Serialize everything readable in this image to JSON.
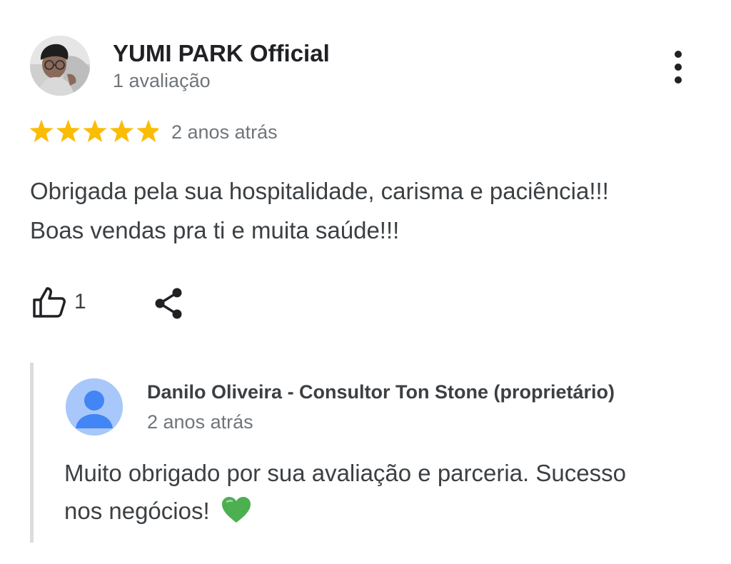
{
  "review": {
    "author_name": "YUMI PARK Official",
    "author_meta": "1 avaliação",
    "rating": 5,
    "rating_max": 5,
    "date": "2 anos atrás",
    "text_line1": "Obrigada pela sua hospitalidade, carisma e paciência!!!",
    "text_line2": "Boas vendas pra ti e muita saúde!!!",
    "like_count": "1"
  },
  "owner_reply": {
    "name": "Danilo Oliveira - Consultor Ton Stone (proprietário)",
    "date": "2 anos atrás",
    "text_line1": "Muito obrigado por sua avaliação e parceria. Sucesso",
    "text_line2": "nos negócios!",
    "emoji": "green-heart"
  },
  "icons": {
    "more": "more-vertical-icon",
    "like": "thumbs-up-icon",
    "share": "share-icon",
    "star": "star-icon"
  },
  "colors": {
    "star": "#fbbc04",
    "heart": "#4caf50",
    "owner_avatar_bg": "#a8c7fa",
    "owner_avatar_fg": "#4285f4",
    "reply_bar": "#dadce0"
  }
}
